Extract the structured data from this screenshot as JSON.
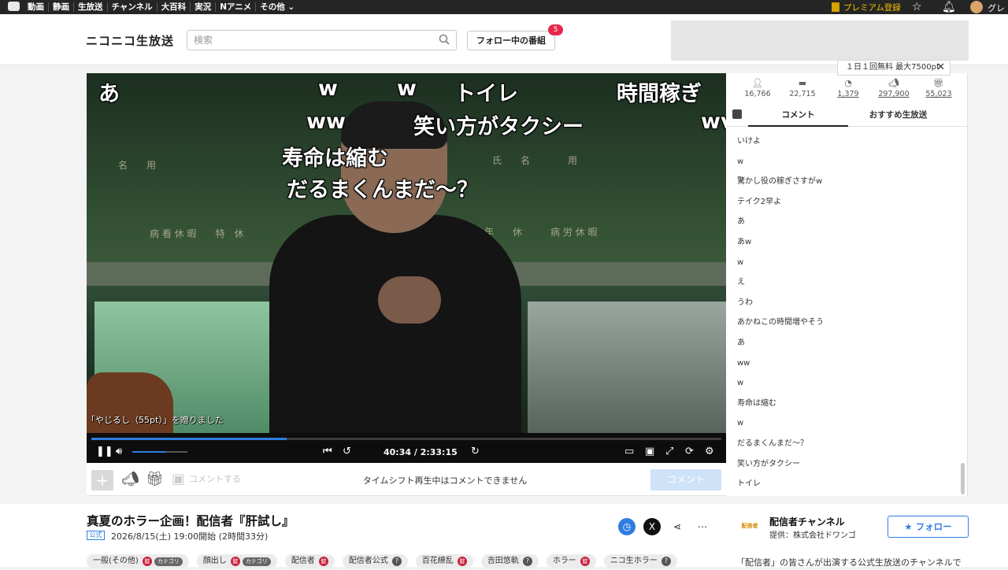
{
  "top_nav": {
    "links": [
      "動画",
      "静画",
      "生放送",
      "チャンネル",
      "大百科",
      "実況",
      "Nアニメ",
      "その他"
    ],
    "premium_label": "プレミアム登録",
    "username": "グレ"
  },
  "header": {
    "logo": "ニコニコ生放送",
    "search_placeholder": "検索",
    "follow_programs_label": "フォロー中の番組",
    "follow_badge_count": "5"
  },
  "player": {
    "overlay_comments": [
      {
        "text": "あ"
      },
      {
        "text": "w"
      },
      {
        "text": "w"
      },
      {
        "text": "トイレ"
      },
      {
        "text": "時間稼ぎ"
      },
      {
        "text": "ww"
      },
      {
        "text": "笑い方がタクシー"
      },
      {
        "text": "wv"
      },
      {
        "text": "寿命は縮む"
      },
      {
        "text": "だるまくんまだ～？"
      }
    ],
    "gift_message": "「やじるし（55pt）」を贈りました",
    "timecode": "40:34 / 2:33:15",
    "progress_fraction": 0.31,
    "volume_fraction": 0.62
  },
  "comment_bar": {
    "input_placeholder": "コメントする",
    "notice": "タイムシフト再生中はコメントできません",
    "send_label": "コメント"
  },
  "side_panel": {
    "tooltip": "１日１回無料 最大7500pt",
    "stats": [
      {
        "icon": "viewer-icon",
        "value": "16,766"
      },
      {
        "icon": "comment-icon",
        "value": "22,715"
      },
      {
        "icon": "ad-icon",
        "value": "1,379"
      },
      {
        "icon": "nicoad-icon",
        "value": "297,900"
      },
      {
        "icon": "gift-icon",
        "value": "55,023"
      }
    ],
    "tabs": [
      "コメント",
      "おすすめ生放送"
    ],
    "comments": [
      "いけよ",
      "w",
      "驚かし役の稼ぎさすがw",
      "テイク2早よ",
      "あ",
      "あw",
      "w",
      "え",
      "うわ",
      "あかねこの時間増やそう",
      "あ",
      "ww",
      "w",
      "寿命は縮む",
      "w",
      "だるまくんまだ～？",
      "笑い方がタクシー",
      "トイレ"
    ]
  },
  "program": {
    "title": "真夏のホラー企画！配信者『肝試し』",
    "badge": "公式",
    "start_info": "2026/8/15(土) 19:00開始  (2時間33分)",
    "tags": [
      {
        "label": "一般(その他)",
        "lock": true,
        "category": "カテゴリ"
      },
      {
        "label": "顔出し",
        "lock": true,
        "category": "カテゴリ"
      },
      {
        "label": "配信者",
        "lock": true
      },
      {
        "label": "配信者公式",
        "help": true
      },
      {
        "label": "百花繚乱",
        "lock": true
      },
      {
        "label": "吉田悠軌",
        "help": true
      },
      {
        "label": "ホラー",
        "lock": true
      },
      {
        "label": "ニコ生ホラー",
        "help": true
      }
    ],
    "lock_mark": "🔒",
    "help_mark": "?"
  },
  "channel": {
    "logo_text": "配信者",
    "name": "配信者チャンネル",
    "provider": "提供：株式会社ドワンゴ",
    "follow_label": "フォロー",
    "description": "「配信者」の皆さんが出演する公式生放送のチャンネルで"
  },
  "colors": {
    "accent": "#2f7de1",
    "badge": "#e6294a",
    "premium": "#f2c200"
  }
}
